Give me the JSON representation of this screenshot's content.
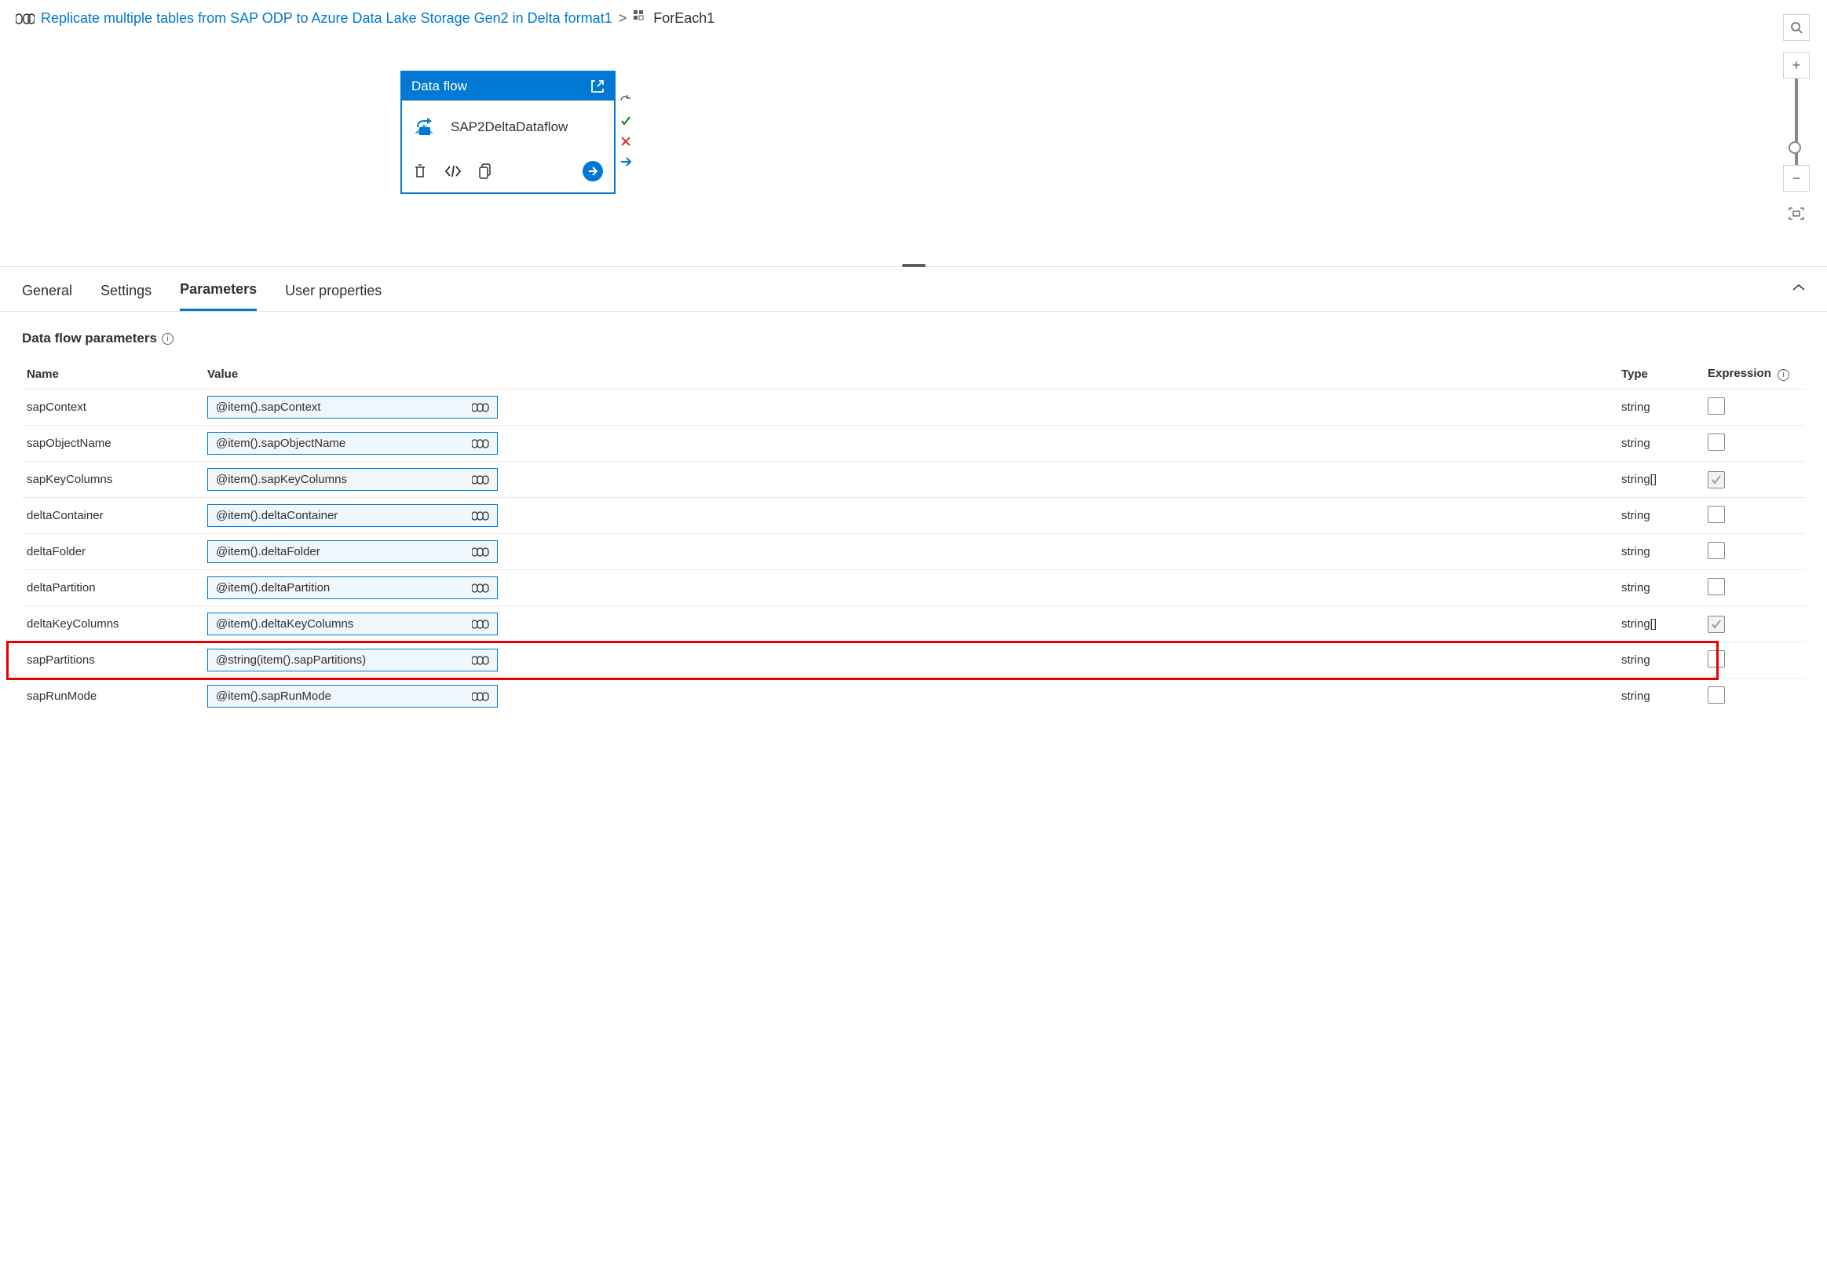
{
  "breadcrumb": {
    "pipeline_name": "Replicate multiple tables from SAP ODP to Azure Data Lake Storage Gen2 in Delta format1",
    "current": "ForEach1"
  },
  "activity": {
    "type_label": "Data flow",
    "name": "SAP2DeltaDataflow"
  },
  "tabs": {
    "general": "General",
    "settings": "Settings",
    "parameters": "Parameters",
    "user_properties": "User properties"
  },
  "section": {
    "title": "Data flow parameters"
  },
  "columns": {
    "name": "Name",
    "value": "Value",
    "type": "Type",
    "expression": "Expression"
  },
  "rows": [
    {
      "name": "sapContext",
      "value": "@item().sapContext",
      "type": "string",
      "checked": false,
      "disabled": false,
      "highlight": false
    },
    {
      "name": "sapObjectName",
      "value": "@item().sapObjectName",
      "type": "string",
      "checked": false,
      "disabled": false,
      "highlight": false
    },
    {
      "name": "sapKeyColumns",
      "value": "@item().sapKeyColumns",
      "type": "string[]",
      "checked": true,
      "disabled": true,
      "highlight": false
    },
    {
      "name": "deltaContainer",
      "value": "@item().deltaContainer",
      "type": "string",
      "checked": false,
      "disabled": false,
      "highlight": false
    },
    {
      "name": "deltaFolder",
      "value": "@item().deltaFolder",
      "type": "string",
      "checked": false,
      "disabled": false,
      "highlight": false
    },
    {
      "name": "deltaPartition",
      "value": "@item().deltaPartition",
      "type": "string",
      "checked": false,
      "disabled": false,
      "highlight": false
    },
    {
      "name": "deltaKeyColumns",
      "value": "@item().deltaKeyColumns",
      "type": "string[]",
      "checked": true,
      "disabled": true,
      "highlight": false
    },
    {
      "name": "sapPartitions",
      "value": "@string(item().sapPartitions)",
      "type": "string",
      "checked": false,
      "disabled": false,
      "highlight": true
    },
    {
      "name": "sapRunMode",
      "value": "@item().sapRunMode",
      "type": "string",
      "checked": false,
      "disabled": false,
      "highlight": false
    }
  ]
}
